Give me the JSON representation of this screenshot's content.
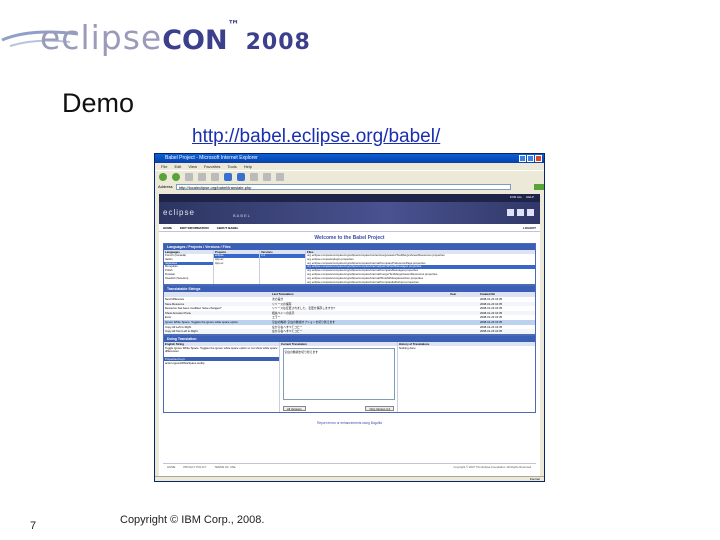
{
  "logo": {
    "eclipse": "eclipse",
    "con": "CON",
    "tm": "™",
    "year": "2008"
  },
  "slide": {
    "title": "Demo",
    "url": "http://babel.eclipse.org/babel/",
    "page_number": "7",
    "copyright": "Copyright © IBM Corp., 2008."
  },
  "browser": {
    "window_title": "Babel Project - Microsoft Internet Explorer",
    "menu": [
      "File",
      "Edit",
      "View",
      "Favorites",
      "Tools",
      "Help"
    ],
    "address_label": "Address",
    "address": "http://localeclipse.org/babel/translate.php",
    "status_zone": "Internet"
  },
  "site": {
    "brand": "eclipse",
    "sub_brand": "BABEL",
    "top_links": [
      "FOR ALL",
      "HELP"
    ],
    "nav": [
      "HOME",
      "EDIT INFORMATION",
      "ABOUT BABEL"
    ],
    "logout": "LOGOUT",
    "welcome": "Welcome to the Babel Project",
    "panels": {
      "lpvf": "Languages / Projects / Versions / Files",
      "strings": "Translatable Strings",
      "translation": "Doing Translation"
    },
    "columns": {
      "languages": "Languages",
      "projects": "Projects",
      "versions": "Versions",
      "files": "Files"
    },
    "languages": [
      "French (Canada)",
      "Italian",
      "Japanese",
      "Mongolian",
      "Polish",
      "Russian",
      "Swedish (Sweden)"
    ],
    "projects": [
      "eclipse",
      "tptp.ac",
      "tptp.ex"
    ],
    "versions": [
      "3.4"
    ],
    "files": [
      "org.eclipse.compare/compare/org/eclipse/compare/contentmergeviewer/TextMergeViewerResources.properties",
      "org.eclipse.compare/plugin.properties",
      "org.eclipse.compare/compare/org/eclipse/compare/internal/ComparePreferencePage.properties",
      "org.eclipse.compare/compare/org/eclipse/compare/internal/patch/PatchMessages.properties",
      "org.eclipse.compare/compare/org/eclipse/compare/internal/CompareMessages.properties",
      "org.eclipse.compare/compare/org/eclipse/compare/internal/merge/TextMergeViewerResources.properties",
      "org.eclipse.compare/compare/org/eclipse/compare/internal/ShowWhitespaceAction.properties",
      "org.eclipse.compare/compare/org/eclipse/compare/internal/CompareEditorInput.properties"
    ],
    "string_headers": [
      "Last Translation",
      "User",
      "Created On"
    ],
    "strings": [
      {
        "key": "Next Difference",
        "trans": "次の差分",
        "user": "",
        "date": "2008-01-23 16:35"
      },
      {
        "key": "Save Resource",
        "trans": "リソースの保存",
        "user": "",
        "date": "2008-01-23 16:35"
      },
      {
        "key": "Resource has been modified. Save changes?",
        "trans": "リソースは変更されました。変更を保存しますか?",
        "user": "",
        "date": "2008-01-23 16:35"
      },
      {
        "key": "Show Ancestor Pane",
        "trans": "祖先ペインの表示",
        "user": "",
        "date": "2008-01-23 16:35"
      },
      {
        "key": "Error",
        "trans": "エラー",
        "user": "",
        "date": "2008-01-23 16:35"
      },
      {
        "key": "Ignore White Space: Toggles the ignore white space option",
        "trans": "空白の無視: 空白の無視オプションを切り替えます",
        "user": "",
        "date": "2008-01-23 16:35"
      },
      {
        "key": "Copy All Left to Right",
        "trans": "左から右へすべてコピー",
        "user": "",
        "date": "2008-01-23 16:35"
      },
      {
        "key": "Copy All from Left to Right",
        "trans": "左から右へすべてコピー",
        "user": "",
        "date": "2008-01-23 16:35"
      }
    ],
    "translation": {
      "english_label": "English String",
      "english_text": "Toggle Ignore White Space: Toggles the ignore white space option to not show white space differences",
      "properties_label": "Properties Keys",
      "properties_value": "action.IgnoreWhiteSpace.tooltip",
      "current_label": "Current Translation",
      "current_text": "空白の無視を切り替えます",
      "history_label": "History of Translations",
      "history_text": "Nothing done",
      "btn_all": "All Versions",
      "btn_only": "Only Version 3.4"
    },
    "report": "Report errors or enhancements using Bugzilla",
    "footer": [
      "HOME",
      "PRIVACY POLICY",
      "TERMS OF USE"
    ],
    "footer_copy": "Copyright © 2007 The Eclipse Foundation. All Rights Reserved."
  },
  "colors": {
    "accent": "#3b5fb5",
    "banner": "#2c3560",
    "url": "#1a2fb0"
  }
}
